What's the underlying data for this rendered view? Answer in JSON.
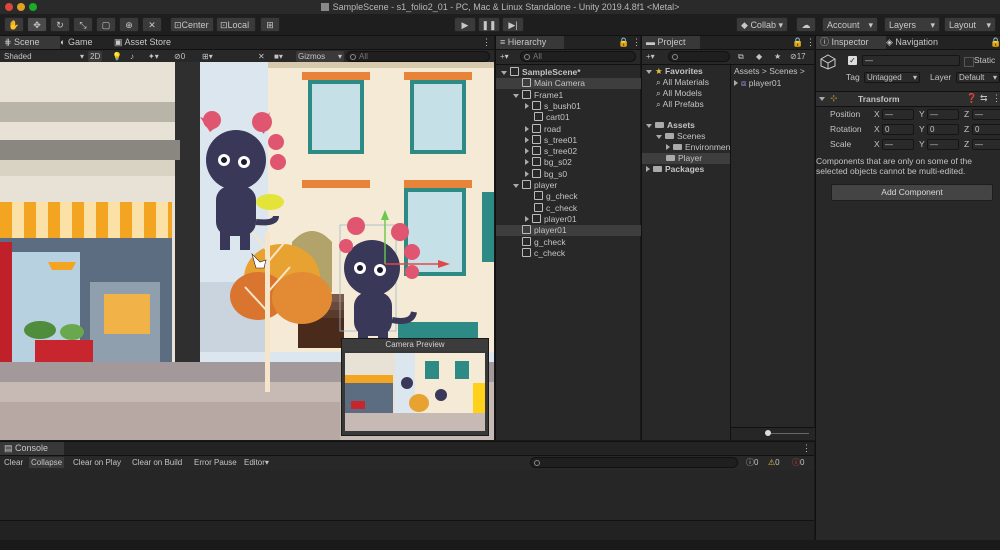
{
  "window": {
    "title": "SampleScene - s1_folio2_01 - PC, Mac & Linux Standalone - Unity 2019.4.8f1 <Metal>"
  },
  "toolbar": {
    "center_label": "Center",
    "local_label": "Local",
    "collab_label": "Collab",
    "account_label": "Account",
    "layers_label": "Layers",
    "layout_label": "Layout"
  },
  "scene_panel": {
    "tabs": [
      "Scene",
      "Game",
      "Asset Store"
    ],
    "shading_mode": "Shaded",
    "mode_2d": "2D",
    "hidden_count": "0",
    "gizmos_label": "Gizmos",
    "search_placeholder": "All",
    "camera_preview_title": "Camera Preview"
  },
  "hierarchy": {
    "title": "Hierarchy",
    "search_placeholder": "All",
    "items": [
      {
        "label": "SampleScene*",
        "depth": 0,
        "icon": "unity-scene-icon",
        "expand": "open",
        "bold": true
      },
      {
        "label": "Main Camera",
        "depth": 1,
        "icon": "cube-icon",
        "expand": "none",
        "selected": true
      },
      {
        "label": "Frame1",
        "depth": 1,
        "icon": "cube-icon",
        "expand": "open"
      },
      {
        "label": "s_bush01",
        "depth": 2,
        "icon": "cube-icon",
        "expand": "closed"
      },
      {
        "label": "cart01",
        "depth": 2,
        "icon": "cube-icon",
        "expand": "none"
      },
      {
        "label": "road",
        "depth": 2,
        "icon": "cube-icon",
        "expand": "closed"
      },
      {
        "label": "s_tree01",
        "depth": 2,
        "icon": "cube-icon",
        "expand": "closed"
      },
      {
        "label": "s_tree02",
        "depth": 2,
        "icon": "cube-icon",
        "expand": "closed"
      },
      {
        "label": "bg_s02",
        "depth": 2,
        "icon": "cube-icon",
        "expand": "closed"
      },
      {
        "label": "bg_s0",
        "depth": 2,
        "icon": "cube-icon",
        "expand": "closed"
      },
      {
        "label": "player",
        "depth": 1,
        "icon": "cube-icon",
        "expand": "open"
      },
      {
        "label": "g_check",
        "depth": 2,
        "icon": "cube-icon",
        "expand": "none"
      },
      {
        "label": "c_check",
        "depth": 2,
        "icon": "cube-icon",
        "expand": "none"
      },
      {
        "label": "player01",
        "depth": 2,
        "icon": "cube-icon",
        "expand": "closed"
      },
      {
        "label": "player01",
        "depth": 1,
        "icon": "cube-icon",
        "expand": "none",
        "selected": true
      },
      {
        "label": "g_check",
        "depth": 1,
        "icon": "cube-icon",
        "expand": "none"
      },
      {
        "label": "c_check",
        "depth": 1,
        "icon": "cube-icon",
        "expand": "none"
      }
    ]
  },
  "project": {
    "title": "Project",
    "hidden_count": "17",
    "breadcrumb": [
      "Assets",
      "Scenes"
    ],
    "tree": [
      {
        "label": "Favorites",
        "depth": 0,
        "kind": "star",
        "bold": true
      },
      {
        "label": "All Materials",
        "depth": 1,
        "kind": "search"
      },
      {
        "label": "All Models",
        "depth": 1,
        "kind": "search"
      },
      {
        "label": "All Prefabs",
        "depth": 1,
        "kind": "search"
      },
      {
        "label": "Assets",
        "depth": 0,
        "kind": "folder",
        "bold": true
      },
      {
        "label": "Scenes",
        "depth": 1,
        "kind": "folder"
      },
      {
        "label": "Environmen",
        "depth": 2,
        "kind": "folder"
      },
      {
        "label": "Player",
        "depth": 2,
        "kind": "folder",
        "selected": true
      },
      {
        "label": "Packages",
        "depth": 0,
        "kind": "folder",
        "bold": true
      }
    ],
    "files": [
      "player01"
    ]
  },
  "inspector": {
    "tabs": [
      "Inspector",
      "Navigation"
    ],
    "object_name": "—",
    "static_label": "Static",
    "tag_label": "Tag",
    "tag_value": "Untagged",
    "layer_label": "Layer",
    "layer_value": "Default",
    "transform_title": "Transform",
    "rows": [
      {
        "label": "Position",
        "x": "—",
        "y": "—",
        "z": "—"
      },
      {
        "label": "Rotation",
        "x": "0",
        "y": "0",
        "z": "0"
      },
      {
        "label": "Scale",
        "x": "—",
        "y": "—",
        "z": "—"
      }
    ],
    "axis_x": "X",
    "axis_y": "Y",
    "axis_z": "Z",
    "note": "Components that are only on some of the selected objects cannot be multi-edited.",
    "add_component_label": "Add Component"
  },
  "console": {
    "title": "Console",
    "buttons": [
      "Clear",
      "Collapse",
      "Clear on Play",
      "Clear on Build",
      "Error Pause",
      "Editor"
    ],
    "counts": {
      "info": "0",
      "warn": "0",
      "error": "0"
    }
  },
  "colors": {
    "accent": "#3a72b0",
    "panel": "#282828",
    "selection": "#3e3e3e"
  }
}
